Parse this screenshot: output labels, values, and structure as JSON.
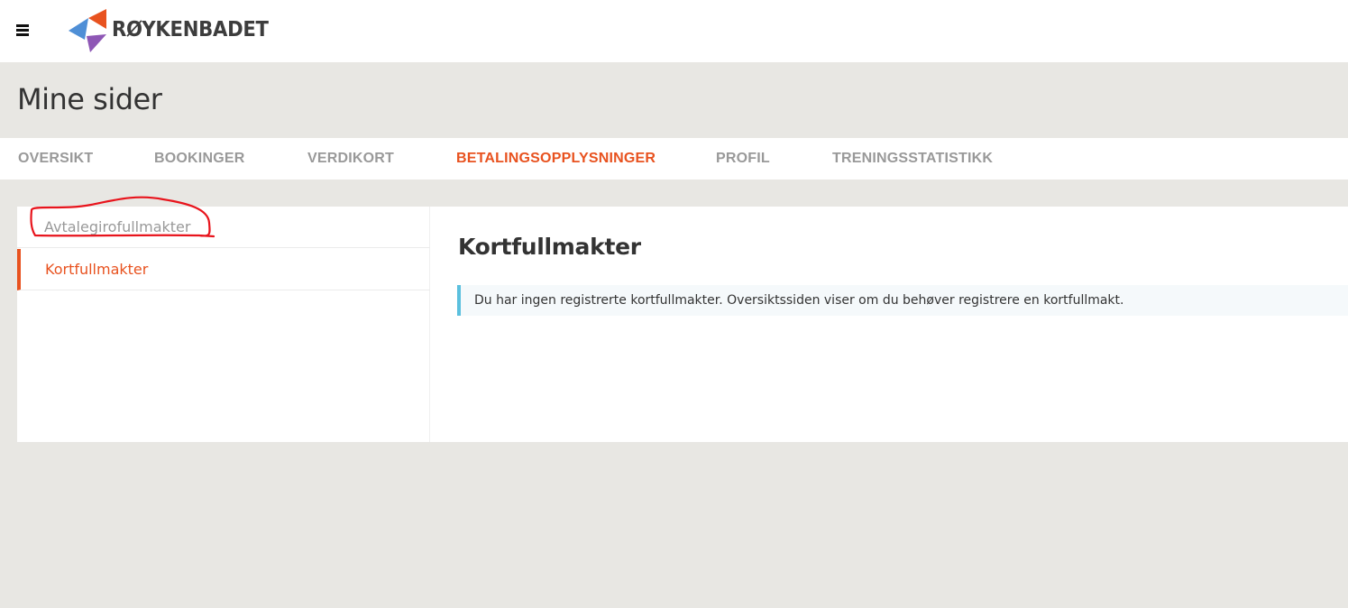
{
  "header": {
    "brand": "RØYKENBADET",
    "menu_icon": "hamburger-icon"
  },
  "page": {
    "title": "Mine sider"
  },
  "tabs": [
    {
      "label": "OVERSIKT",
      "active": false
    },
    {
      "label": "BOOKINGER",
      "active": false
    },
    {
      "label": "VERDIKORT",
      "active": false
    },
    {
      "label": "BETALINGSOPPLYSNINGER",
      "active": true
    },
    {
      "label": "PROFIL",
      "active": false
    },
    {
      "label": "TRENINGSSTATISTIKK",
      "active": false
    }
  ],
  "sidebar": {
    "items": [
      {
        "label": "Avtalegirofullmakter",
        "active": false
      },
      {
        "label": "Kortfullmakter",
        "active": true
      }
    ]
  },
  "content": {
    "title": "Kortfullmakter",
    "alert": "Du har ingen registrerte kortfullmakter. Oversiktssiden viser om du behøver registrere en kortfullmakt."
  },
  "colors": {
    "accent": "#e8521f",
    "info_border": "#5bc0de",
    "annotation": "#e8141c",
    "background": "#e8e7e3"
  }
}
